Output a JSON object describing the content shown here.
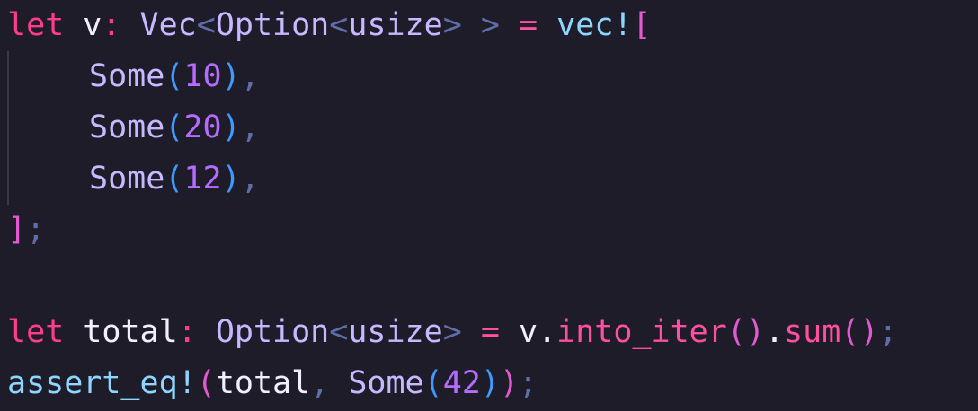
{
  "editor": {
    "lines": [
      {
        "tokens": [
          "let",
          " ",
          "v",
          ":",
          " ",
          "Vec",
          "<",
          "Option",
          "<",
          "usize",
          ">",
          " ",
          ">",
          " ",
          "=",
          " ",
          "vec",
          "!",
          "["
        ]
      },
      {
        "tokens": [
          "Some",
          "(",
          "10",
          ")",
          ","
        ]
      },
      {
        "tokens": [
          "Some",
          "(",
          "20",
          ")",
          ","
        ]
      },
      {
        "tokens": [
          "Some",
          "(",
          "12",
          ")",
          ","
        ]
      },
      {
        "tokens": [
          "]",
          ";"
        ]
      },
      {
        "tokens": []
      },
      {
        "tokens": [
          "let",
          " ",
          "total",
          ":",
          " ",
          "Option",
          "<",
          "usize",
          ">",
          " ",
          "=",
          " ",
          "v",
          ".",
          "into_iter",
          "(",
          ")",
          ".",
          "sum",
          "(",
          ")",
          ";"
        ]
      },
      {
        "tokens": [
          "assert_eq",
          "!",
          "(",
          "total",
          ",",
          " ",
          "Some",
          "(",
          "42",
          ")",
          ")",
          ";"
        ]
      }
    ]
  },
  "colors": {
    "background": "#1f1c29",
    "keyword": "#ff3d8f",
    "type": "#c7b8ff",
    "number": "#b46cff",
    "macro": "#8ed6ff"
  }
}
